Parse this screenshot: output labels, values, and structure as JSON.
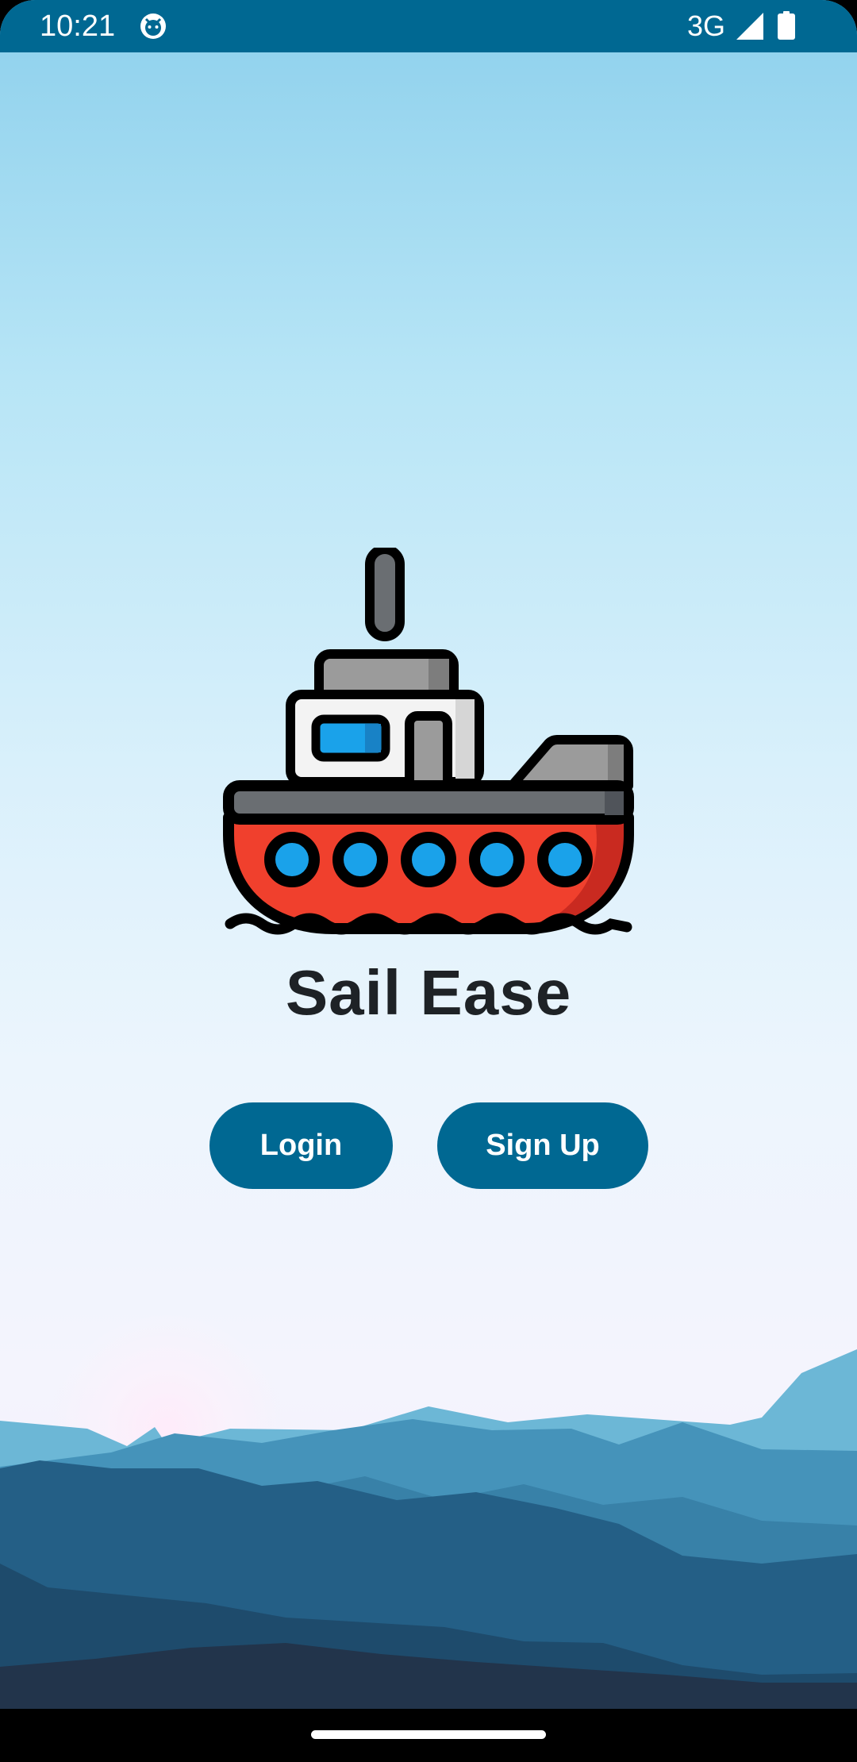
{
  "status_bar": {
    "time": "10:21",
    "network": "3G",
    "background_color": "#006892",
    "icons": [
      "notification-face-icon",
      "signal-icon",
      "battery-icon"
    ]
  },
  "app": {
    "title": "Sail Ease",
    "logo": "ship-icon"
  },
  "actions": {
    "login_label": "Login",
    "signup_label": "Sign Up",
    "button_color": "#006892"
  },
  "navigation_bar": {
    "icons": [
      "home-handle"
    ]
  }
}
